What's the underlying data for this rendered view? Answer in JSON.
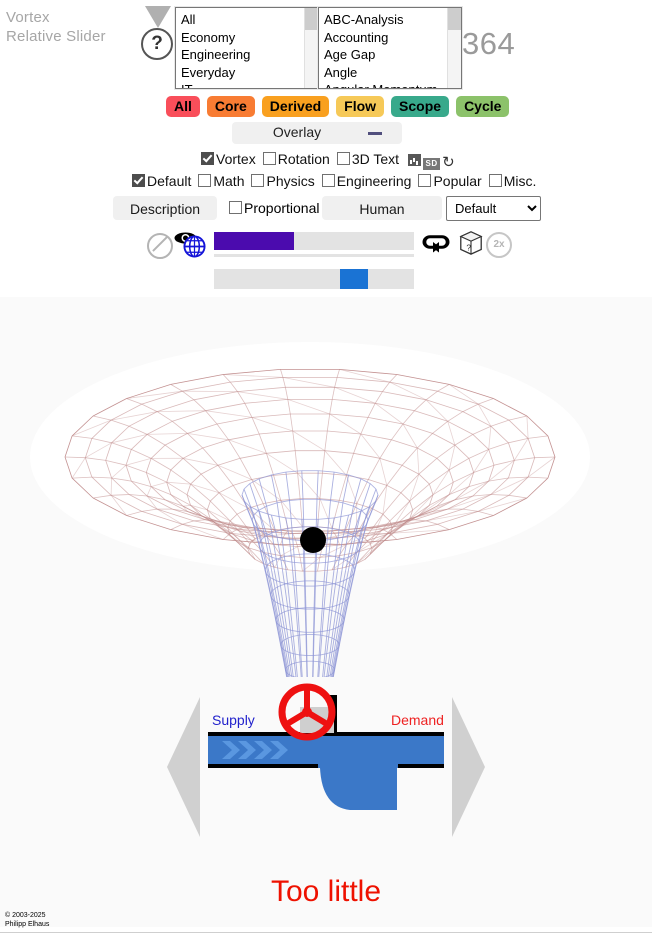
{
  "title": {
    "line1": "Vortex",
    "line2": "Relative Slider"
  },
  "help": {
    "glyph": "?",
    "name": "help-button"
  },
  "listbox_category": {
    "name": "category-listbox",
    "items": [
      "All",
      "Economy",
      "Engineering",
      "Everyday",
      "IT"
    ]
  },
  "listbox_topic": {
    "name": "topic-listbox",
    "items": [
      "ABC-Analysis",
      "Accounting",
      "Age Gap",
      "Angle",
      "Angular Momentum"
    ]
  },
  "count": "364",
  "pills": [
    {
      "label": "All",
      "color": "#f94e5a"
    },
    {
      "label": "Core",
      "color": "#f87c33"
    },
    {
      "label": "Derived",
      "color": "#f9a01f"
    },
    {
      "label": "Flow",
      "color": "#f6c958"
    },
    {
      "label": "Scope",
      "color": "#38a98b"
    },
    {
      "label": "Cycle",
      "color": "#8cc26a"
    }
  ],
  "overlay": {
    "label": "Overlay",
    "minus_color": "#514f7d"
  },
  "checkbox_row_1": [
    {
      "label": "Vortex",
      "checked": true
    },
    {
      "label": "Rotation",
      "checked": false
    },
    {
      "label": "3D Text",
      "checked": false
    }
  ],
  "row_1_icons": [
    {
      "name": "chart-icon",
      "label": ""
    },
    {
      "name": "sd-badge-icon",
      "label": "SD"
    },
    {
      "name": "refresh-icon",
      "label": "↻"
    }
  ],
  "checkbox_row_2": [
    {
      "label": "Default",
      "checked": true
    },
    {
      "label": "Math",
      "checked": false
    },
    {
      "label": "Physics",
      "checked": false
    },
    {
      "label": "Engineering",
      "checked": false
    },
    {
      "label": "Popular",
      "checked": false
    },
    {
      "label": "Misc.",
      "checked": false
    }
  ],
  "description_row": {
    "description_label": "Description",
    "proportional_label": "Proportional",
    "proportional_checked": false,
    "human_label": "Human",
    "select_value": "Default",
    "select_options": [
      "Default"
    ]
  },
  "slider_row": {
    "progress_percent": 40,
    "progress_fill_color": "#4b0bae",
    "track_color": "#e3e3e3",
    "icons": [
      {
        "name": "no-entry-icon"
      },
      {
        "name": "eye-icon"
      },
      {
        "name": "globe-icon"
      },
      {
        "name": "loop-icon"
      },
      {
        "name": "dice-icon"
      },
      {
        "name": "speed-2x-icon",
        "label": "2x"
      }
    ]
  },
  "slider_2": {
    "position_percent": 73,
    "thumb_color": "#1a73d4"
  },
  "vortex": {
    "name": "vortex-visualization",
    "funnel_color": "#c08b8b",
    "cone_color": "#8e96d6",
    "ball_color": "#000000"
  },
  "supply_demand": {
    "supply_label": "Supply",
    "supply_color": "#2222cc",
    "demand_label": "Demand",
    "demand_color": "#ee2222",
    "pipe_color": "#3b78c8",
    "arrow_color": "#d0d0d0",
    "valve_color": "#ee1111"
  },
  "verdict": "Too little",
  "footer": {
    "line1": "© 2003-2025",
    "line2": "Philipp Elhaus"
  }
}
